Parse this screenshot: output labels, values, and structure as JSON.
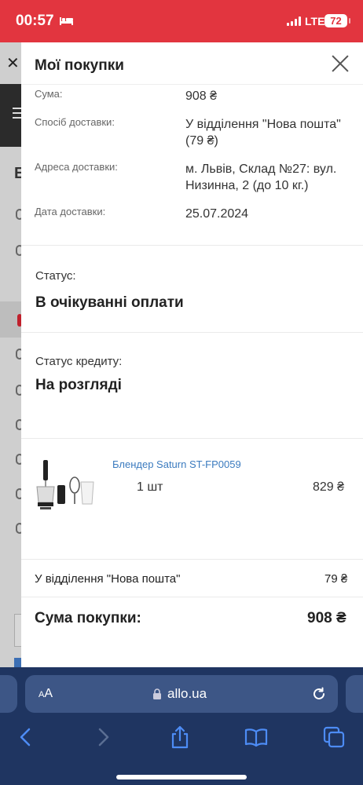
{
  "status_bar": {
    "time": "00:57",
    "network": "LTE",
    "battery": "72",
    "colors": {
      "background": "#e2353f"
    }
  },
  "background_page": {
    "close_icon": "close-icon",
    "first_letter": "Е"
  },
  "modal": {
    "title": "Мої покупки",
    "order_info": [
      {
        "label": "Сума:",
        "value": "908 ₴"
      },
      {
        "label": "Спосіб доставки:",
        "value": "У відділення \"Нова пошта\" (79 ₴)"
      },
      {
        "label": "Адреса доставки:",
        "value": "м. Львів, Склад №27: вул. Низинна, 2 (до 10 кг.)"
      },
      {
        "label": "Дата доставки:",
        "value": "25.07.2024"
      }
    ],
    "status": {
      "label": "Статус:",
      "value": "В очікуванні оплати"
    },
    "credit_status": {
      "label": "Статус кредиту:",
      "value": "На розгляді"
    },
    "product": {
      "name": "Блендер Saturn ST-FP0059",
      "quantity": "1 шт",
      "price": "829 ₴"
    },
    "delivery": {
      "label": "У відділення \"Нова пошта\"",
      "price": "79 ₴"
    },
    "total": {
      "label": "Сума покупки:",
      "value": "908 ₴"
    },
    "colors": {
      "link": "#3b7bbf",
      "text": "#222222"
    }
  },
  "browser": {
    "text_size_label": "AA",
    "url": "allo.ua",
    "colors": {
      "toolbar": "#1f3561",
      "urlbar": "#3d5686",
      "icons": "#4d8cf5"
    }
  }
}
